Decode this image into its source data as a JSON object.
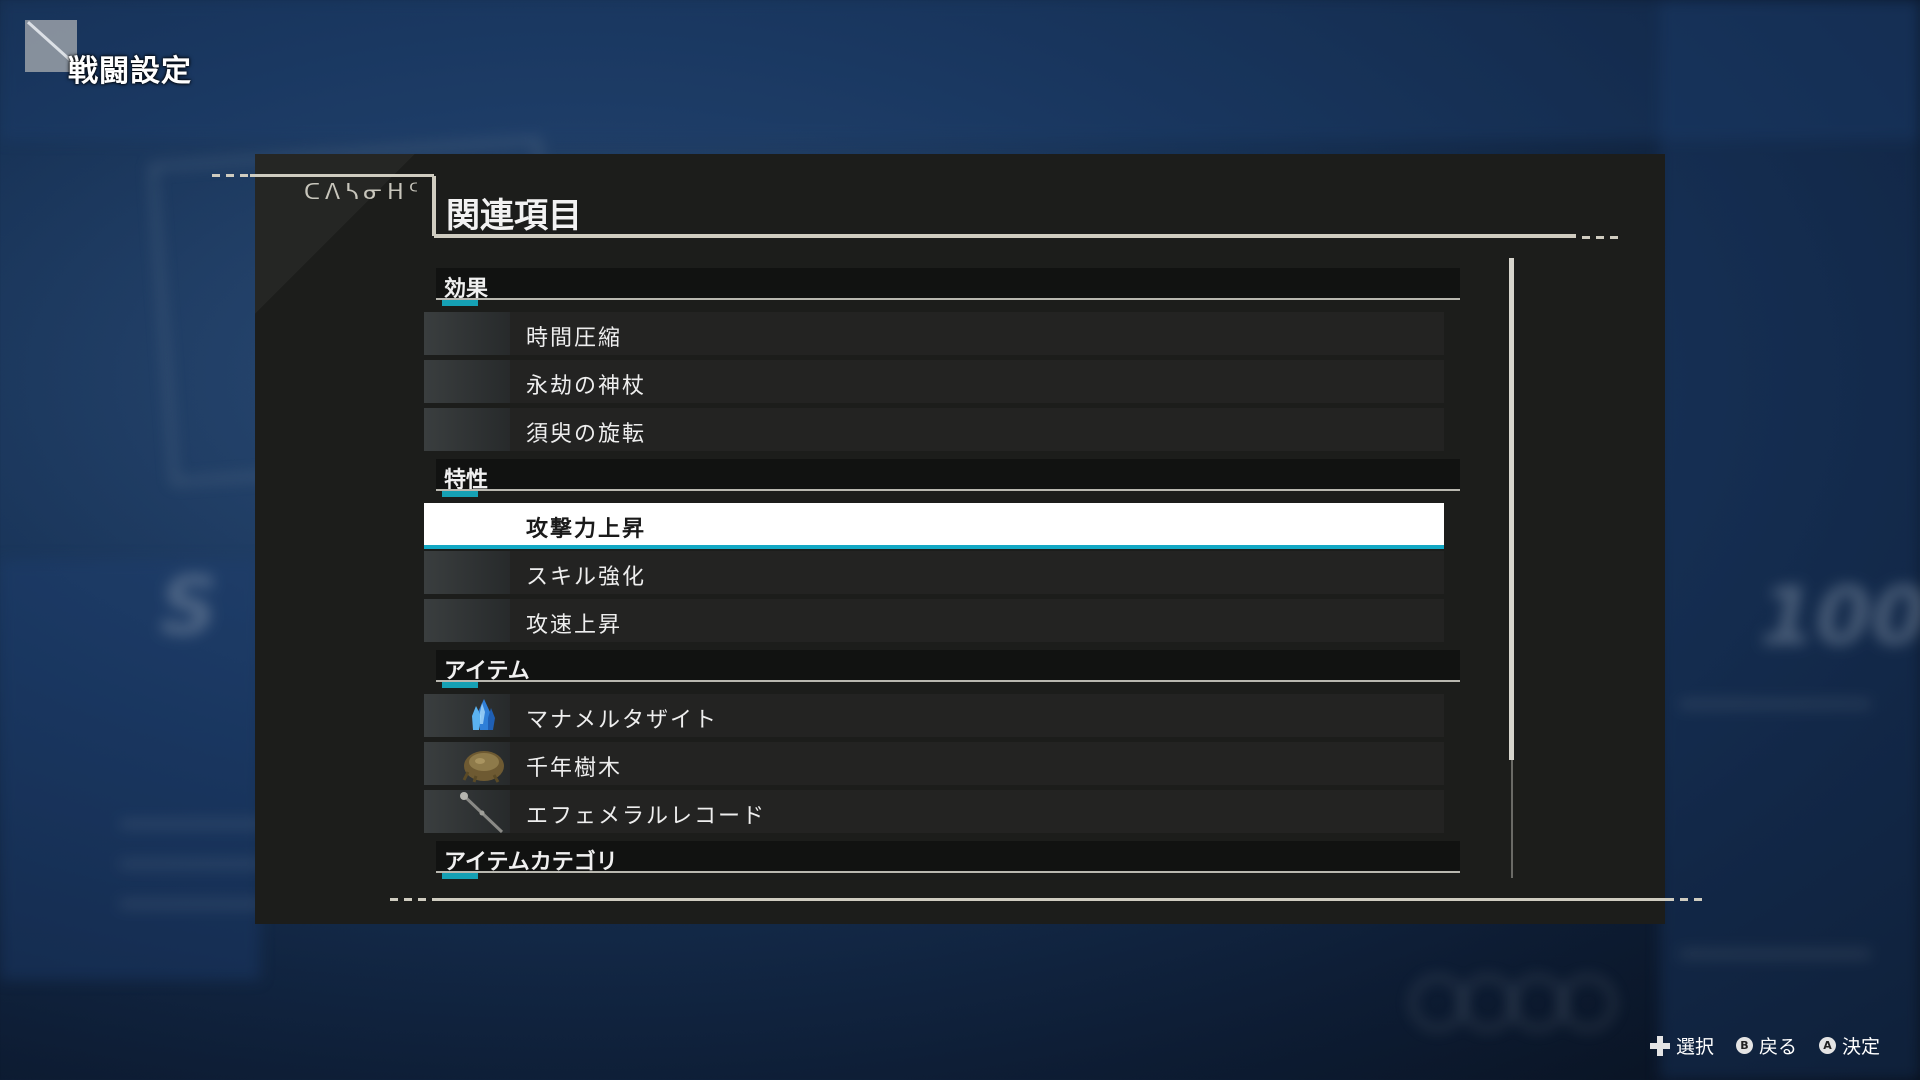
{
  "header": {
    "title": "戦闘設定"
  },
  "panel": {
    "label": "ᑕᐱᓴᓂᕼᑦ",
    "title": "関連項目"
  },
  "sections": [
    {
      "title": "効果",
      "items": [
        {
          "label": "時間圧縮",
          "icon": ""
        },
        {
          "label": "永劫の神杖",
          "icon": ""
        },
        {
          "label": "須臾の旋転",
          "icon": ""
        }
      ]
    },
    {
      "title": "特性",
      "items": [
        {
          "label": "攻撃力上昇",
          "icon": "",
          "selected": true
        },
        {
          "label": "スキル強化",
          "icon": ""
        },
        {
          "label": "攻速上昇",
          "icon": ""
        }
      ]
    },
    {
      "title": "アイテム",
      "items": [
        {
          "label": "マナメルタザイト",
          "icon": "blue-crystal-icon"
        },
        {
          "label": "千年樹木",
          "icon": "tree-stump-icon"
        },
        {
          "label": "エフェメラルレコード",
          "icon": "wand-icon"
        }
      ]
    },
    {
      "title": "アイテムカテゴリ",
      "items": []
    }
  ],
  "controls": [
    {
      "icon": "dpad-icon",
      "label": "選択"
    },
    {
      "icon": "b-button-icon",
      "badge": "B",
      "label": "戻る"
    },
    {
      "icon": "a-button-icon",
      "badge": "A",
      "label": "決定"
    }
  ],
  "colors": {
    "accent": "#12a8c4",
    "panel": "#1c1d1b",
    "selected_bg": "#ffffff"
  }
}
